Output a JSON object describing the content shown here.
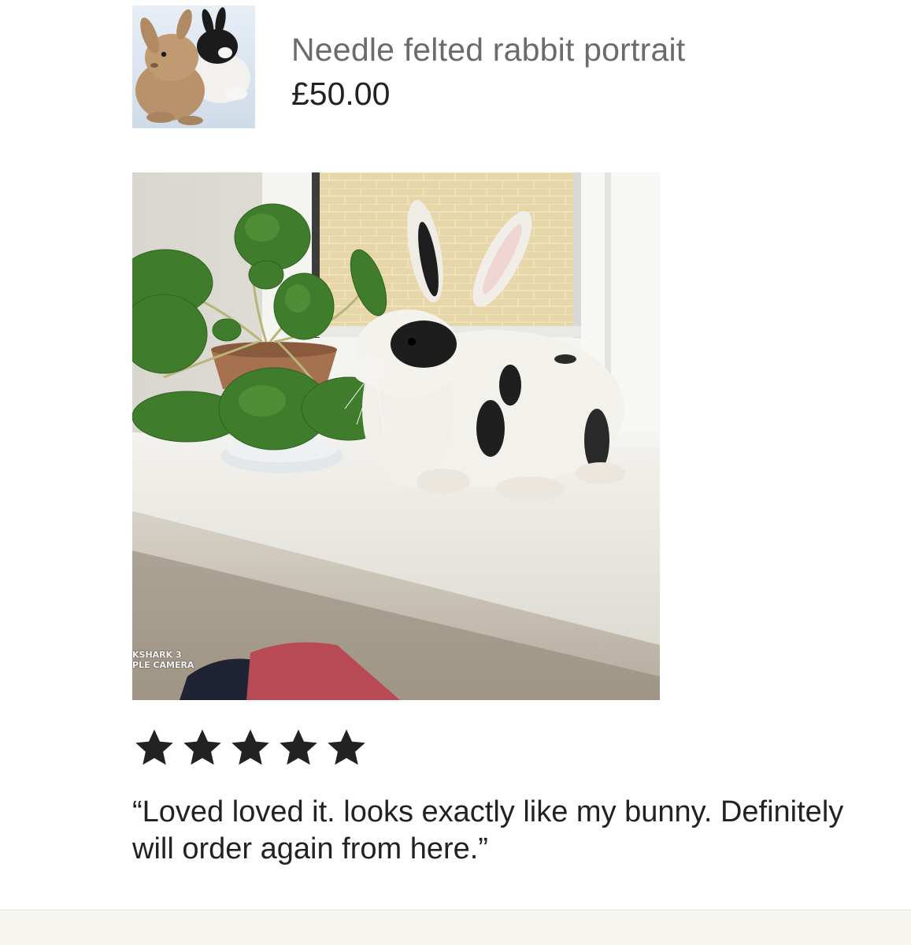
{
  "product": {
    "title": "Needle felted rabbit portrait",
    "price": "£50.00",
    "thumbnail_icon": "felted-rabbits-thumbnail"
  },
  "review": {
    "photo_icon": "felted-rabbit-on-windowsill-photo",
    "photo_watermark_line1": "KSHARK 3",
    "photo_watermark_line2": "PLE CAMERA",
    "rating": 5,
    "rating_max": 5,
    "text": "“Loved loved it. looks exactly like my bunny. Definitely will order again from here.”"
  },
  "colors": {
    "title_gray": "#6b6b6b",
    "text_dark": "#222222",
    "star_fill": "#222222",
    "bottom_strip": "#f6f5f0"
  }
}
